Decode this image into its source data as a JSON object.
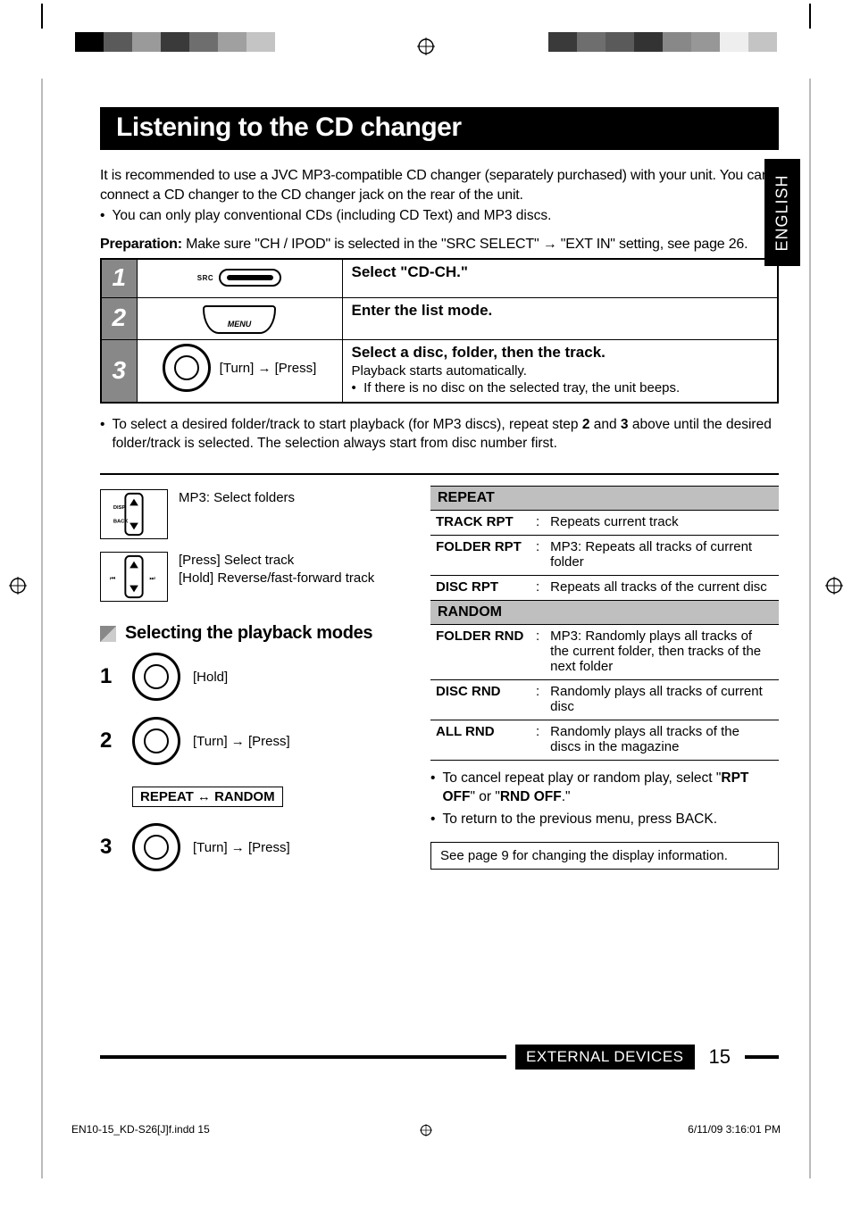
{
  "language_tab": "ENGLISH",
  "title": "Listening to the CD changer",
  "intro_p1": "It is recommended to use a JVC MP3-compatible CD changer (separately purchased) with your unit. You can connect a CD changer to the CD changer jack on the rear of the unit.",
  "intro_bullet": "You can only play conventional CDs (including CD Text) and MP3 discs.",
  "prep_label": "Preparation:",
  "prep_text": " Make sure \"CH / IPOD\" is selected in the \"SRC SELECT\" → \"EXT IN\" setting, see page 26.",
  "steps": [
    {
      "num": "1",
      "button_label": "SRC",
      "instruction_title": "Select \"CD-CH.\""
    },
    {
      "num": "2",
      "button_label": "MENU",
      "instruction_title": "Enter the list mode."
    },
    {
      "num": "3",
      "turn_press": "[Turn] → [Press]",
      "instruction_title": "Select a disc, folder, then the track.",
      "sub": "Playback starts automatically.",
      "sub_bullet": "If there is no disc on the selected tray, the unit beeps."
    }
  ],
  "after_table_bullet_pre": "To select a desired folder/track to start playback (for MP3 discs), repeat step ",
  "after_table_bullet_mid": " and ",
  "after_table_bullet_post": " above until the desired folder/track is selected. The selection always start from disc number first.",
  "after_table_nums": [
    "2",
    "3"
  ],
  "dpad1": "MP3: Select folders",
  "dpad2_line1": "[Press]   Select track",
  "dpad2_line2": "[Hold]   Reverse/fast-forward track",
  "subhead": "Selecting the playback modes",
  "pm_steps": {
    "s1": "1",
    "s1_note": "[Hold]",
    "s2": "2",
    "s2_note": "[Turn] → [Press]",
    "toggle_a": "REPEAT",
    "toggle_b": "RANDOM",
    "s3": "3",
    "s3_note": "[Turn] → [Press]"
  },
  "opt_sections": [
    {
      "header": "REPEAT",
      "rows": [
        {
          "k": "TRACK RPT",
          "v": "Repeats current track"
        },
        {
          "k": "FOLDER RPT",
          "v": "MP3: Repeats all tracks of current folder"
        },
        {
          "k": "DISC RPT",
          "v": "Repeats all tracks of the current disc"
        }
      ]
    },
    {
      "header": "RANDOM",
      "rows": [
        {
          "k": "FOLDER RND",
          "v": "MP3: Randomly plays all tracks of the current folder, then tracks of the next folder"
        },
        {
          "k": "DISC RND",
          "v": "Randomly plays all tracks of current disc"
        },
        {
          "k": "ALL RND",
          "v": "Randomly plays all tracks of the discs in the magazine"
        }
      ]
    }
  ],
  "note1_pre": "To cancel repeat play or random play, select \"",
  "note1_b1": "RPT OFF",
  "note1_mid": "\" or \"",
  "note1_b2": "RND OFF",
  "note1_post": ".\"",
  "note2": "To return to the previous menu, press BACK.",
  "see_box": "See page 9 for changing the display information.",
  "footer_section": "EXTERNAL DEVICES",
  "footer_page": "15",
  "imprint_file": "EN10-15_KD-S26[J]f.indd   15",
  "imprint_time": "6/11/09   3:16:01 PM",
  "colorbars_left": [
    "#000",
    "#5a5a5a",
    "#9a9a9a",
    "#3a3a3a",
    "#6e6e6e",
    "#a0a0a0",
    "#c4c4c4"
  ],
  "colorbars_right": [
    "#3a3a3a",
    "#6e6e6e",
    "#5a5a5a",
    "#333",
    "#888",
    "#979797",
    "#eee",
    "#c4c4c4"
  ]
}
